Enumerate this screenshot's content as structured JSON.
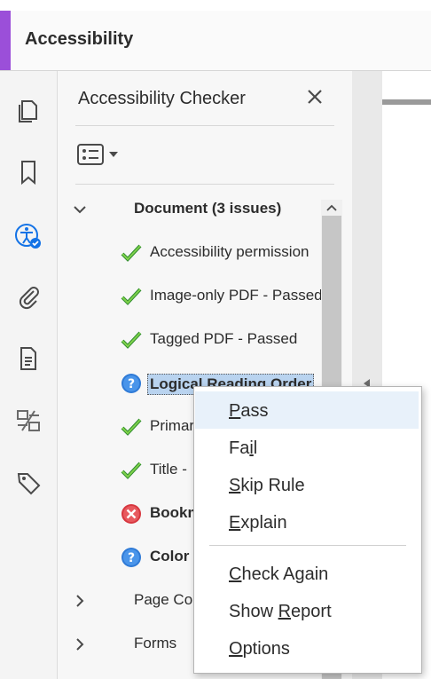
{
  "app": {
    "title": "Accessibility",
    "accent_color": "#9b4fd9"
  },
  "left_rail": {
    "icons": [
      "pages-icon",
      "bookmark-icon",
      "accessibility-icon",
      "attachment-icon",
      "document-properties-icon",
      "compare-icon",
      "tags-icon"
    ]
  },
  "panel": {
    "title": "Accessibility Checker",
    "close_icon": "close-icon",
    "options_icon": "options-list-icon"
  },
  "tree": {
    "document": {
      "label": "Document (3 issues)",
      "expanded": true
    },
    "items": [
      {
        "label": "Accessibility permission",
        "status": "passed"
      },
      {
        "label": "Image-only PDF - Passed",
        "status": "passed"
      },
      {
        "label": "Tagged PDF - Passed",
        "status": "passed"
      },
      {
        "label": "Logical Reading Order",
        "status": "needs-check",
        "selected": true
      },
      {
        "label": "Primar",
        "status": "passed"
      },
      {
        "label": "Title -",
        "status": "passed"
      },
      {
        "label": "Bookm",
        "status": "failed"
      },
      {
        "label": "Color",
        "status": "needs-check"
      }
    ],
    "sections": [
      {
        "label": "Page Co",
        "expanded": false
      },
      {
        "label": "Forms",
        "expanded": false
      }
    ]
  },
  "context_menu": {
    "items": [
      {
        "pre": "",
        "key": "P",
        "post": "ass",
        "hover": true
      },
      {
        "pre": "Fa",
        "key": "i",
        "post": "l"
      },
      {
        "pre": "",
        "key": "S",
        "post": "kip Rule"
      },
      {
        "pre": "",
        "key": "E",
        "post": "xplain"
      },
      {
        "pre": "",
        "key": "C",
        "post": "heck Again"
      },
      {
        "pre": "Show ",
        "key": "R",
        "post": "eport"
      },
      {
        "pre": "",
        "key": "O",
        "post": "ptions"
      }
    ]
  }
}
